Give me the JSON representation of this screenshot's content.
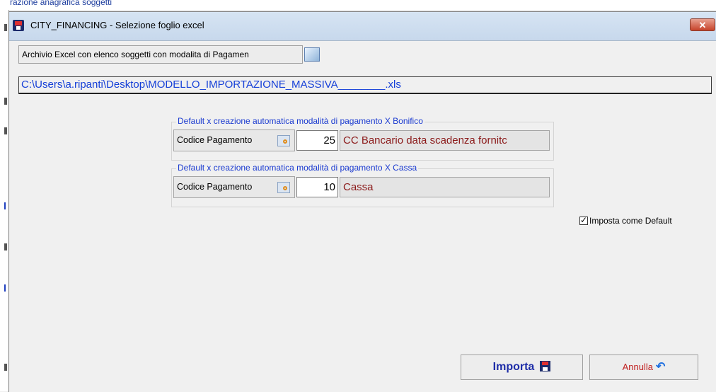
{
  "background_window": {
    "title_fragment": "razione anagrafica soggetti"
  },
  "window": {
    "title": "CITY_FINANCING - Selezione foglio excel",
    "close_label": "✕"
  },
  "archive": {
    "button_label": "Archivio Excel con elenco soggetti con modalita di Pagamen",
    "file_path": "C:\\Users\\a.ripanti\\Desktop\\MODELLO_IMPORTAZIONE_MASSIVA________.xls"
  },
  "bonifico_group": {
    "legend": "Default x creazione automatica modalità di pagamento X Bonifico",
    "code_label": "Codice Pagamento",
    "code_value": "25",
    "code_description": "CC Bancario  data scadenza fornitc"
  },
  "cassa_group": {
    "legend": "Default x creazione automatica modalità di pagamento X Cassa",
    "code_label": "Codice Pagamento",
    "code_value": "10",
    "code_description": "Cassa"
  },
  "default_checkbox": {
    "label": "Imposta come Default",
    "checked": true
  },
  "buttons": {
    "import_label": "Importa",
    "cancel_label": "Annulla"
  },
  "colors": {
    "accent_blue": "#1a3ad0",
    "description_red": "#8b1a1a"
  }
}
